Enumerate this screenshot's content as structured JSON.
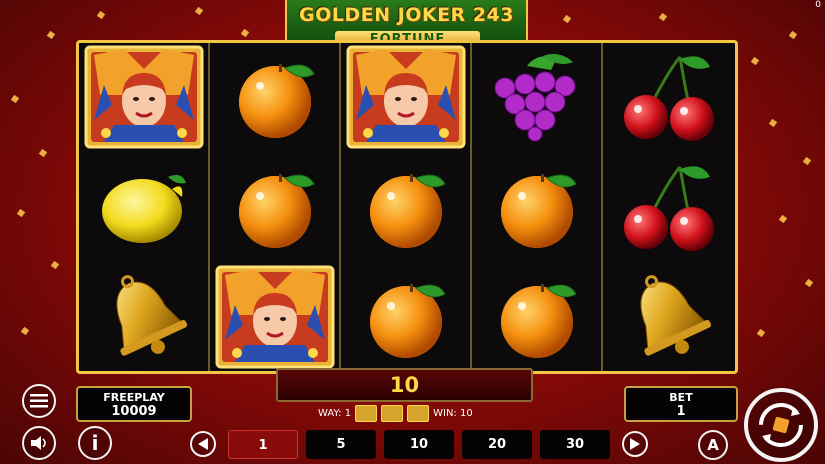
{
  "game": {
    "title": "GOLDEN JOKER 243",
    "subtitle": "FORTUNE",
    "corner_value": "0"
  },
  "reels": [
    [
      "joker",
      "lemon",
      "bell"
    ],
    [
      "orange",
      "orange",
      "joker"
    ],
    [
      "joker",
      "orange",
      "orange"
    ],
    [
      "grapes",
      "orange",
      "orange"
    ],
    [
      "cherry",
      "cherry",
      "bell"
    ]
  ],
  "win": {
    "amount": "10",
    "way_label": "WAY: 1",
    "win_label": "WIN: 10",
    "way_symbols": [
      "joker",
      "joker",
      "joker"
    ]
  },
  "freeplay": {
    "label": "FREEPLAY",
    "value": "10009"
  },
  "bet": {
    "label": "BET",
    "value": "1"
  },
  "bet_options": [
    "1",
    "5",
    "10",
    "20",
    "30"
  ],
  "bet_selected": "1",
  "auto_label": "A",
  "info_label": "i",
  "colors": {
    "accent_gold": "#f2c542",
    "background_red": "#c8120e",
    "logo_green": "#2a7a1a"
  }
}
